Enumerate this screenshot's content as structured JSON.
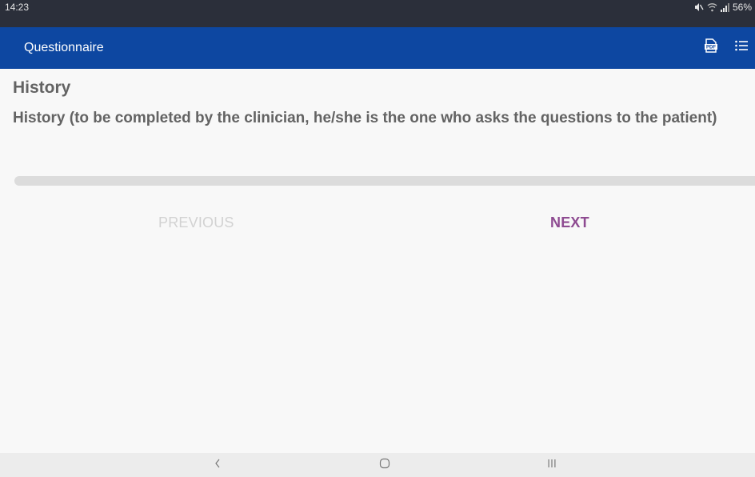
{
  "status_bar": {
    "time": "14:23",
    "battery": "56%",
    "icons": [
      "mute-icon",
      "wifi-icon",
      "signal-icon"
    ]
  },
  "app_bar": {
    "title": "Questionnaire",
    "actions": [
      "pdf-icon",
      "list-icon"
    ]
  },
  "content": {
    "section_title": "History",
    "question": "History (to be completed by the clinician, he/she is the one who asks the questions to the patient)",
    "progress": 0
  },
  "buttons": {
    "previous_label": "PREVIOUS",
    "next_label": "NEXT",
    "previous_enabled": false
  },
  "colors": {
    "app_bar": "#0d47a1",
    "status_bar": "#2b2f3a",
    "accent": "#8e4b91",
    "text": "#636363",
    "disabled": "#d2d2d2"
  },
  "nav_bar": {
    "keys": [
      "back-icon",
      "home-icon",
      "recents-icon"
    ]
  }
}
